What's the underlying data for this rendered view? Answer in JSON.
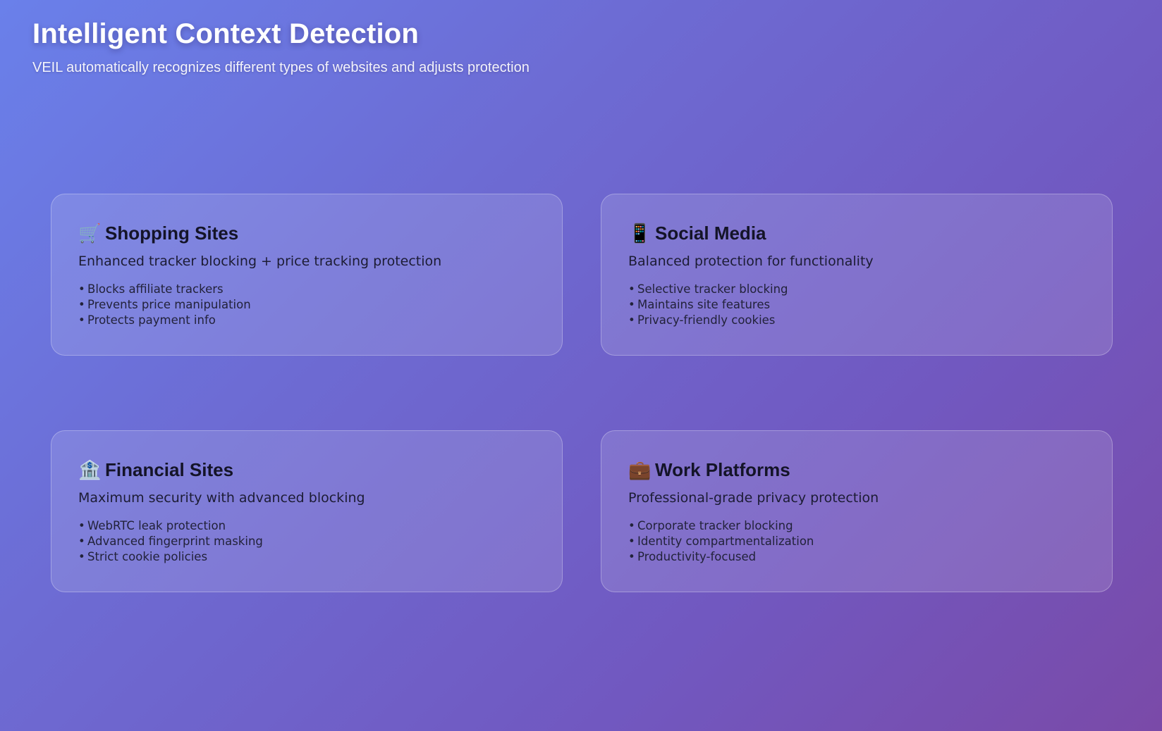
{
  "header": {
    "title": "Intelligent Context Detection",
    "subtitle": "VEIL automatically recognizes different types of websites and adjusts protection"
  },
  "cards": [
    {
      "icon": "🛒",
      "icon_name": "shopping-cart-icon",
      "title": "Shopping Sites",
      "description": "Enhanced tracker blocking + price tracking protection",
      "features": [
        "Blocks affiliate trackers",
        "Prevents price manipulation",
        "Protects payment info"
      ]
    },
    {
      "icon": "📱",
      "icon_name": "mobile-phone-icon",
      "title": "Social Media",
      "description": "Balanced protection for functionality",
      "features": [
        "Selective tracker blocking",
        "Maintains site features",
        "Privacy-friendly cookies"
      ]
    },
    {
      "icon": "🏦",
      "icon_name": "bank-icon",
      "title": "Financial Sites",
      "description": "Maximum security with advanced blocking",
      "features": [
        "WebRTC leak protection",
        "Advanced fingerprint masking",
        "Strict cookie policies"
      ]
    },
    {
      "icon": "💼",
      "icon_name": "briefcase-icon",
      "title": "Work Platforms",
      "description": "Professional-grade privacy protection",
      "features": [
        "Corporate tracker blocking",
        "Identity compartmentalization",
        "Productivity-focused"
      ]
    }
  ],
  "bullet": "•"
}
